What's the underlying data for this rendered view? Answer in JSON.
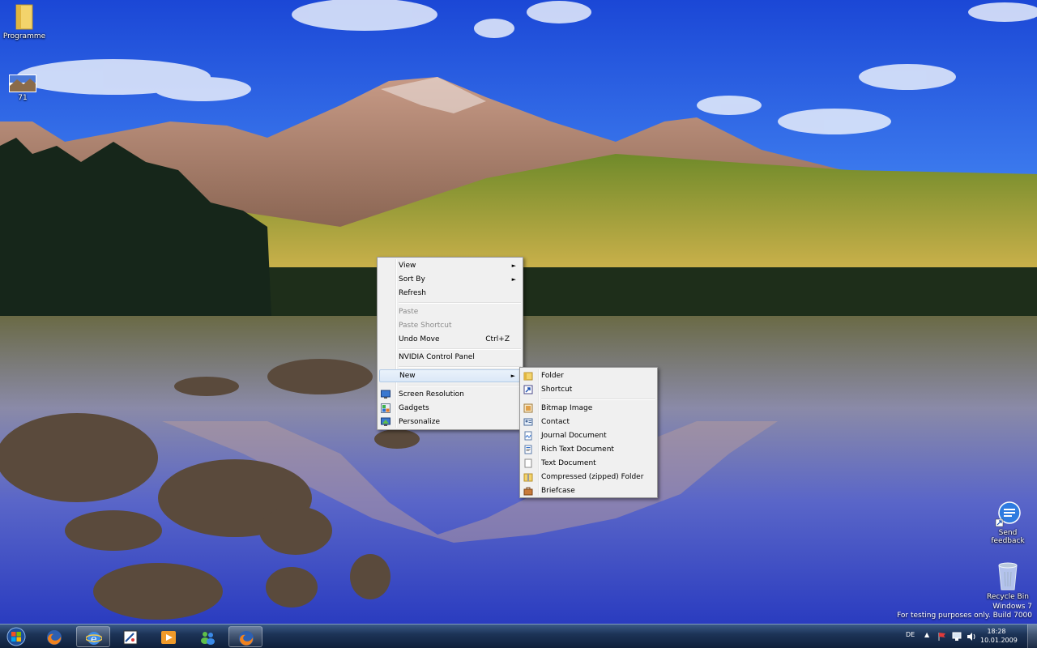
{
  "desktop": {
    "icons": [
      {
        "label": "Programme",
        "icon": "folder-icon"
      },
      {
        "label": "71",
        "icon": "image-file-icon"
      },
      {
        "label_line1": "Send",
        "label_line2": "feedback",
        "icon": "send-feedback-icon"
      },
      {
        "label": "Recycle Bin",
        "icon": "recycle-bin-icon"
      }
    ],
    "watermark": {
      "line1": "Windows 7",
      "line2": "For testing purposes only. Build 7000"
    }
  },
  "context_menu": {
    "items": [
      {
        "label": "View",
        "submenu": true
      },
      {
        "label": "Sort By",
        "submenu": true
      },
      {
        "label": "Refresh"
      },
      {
        "label": "Paste",
        "disabled": true
      },
      {
        "label": "Paste Shortcut",
        "disabled": true
      },
      {
        "label": "Undo Move",
        "accelerator": "Ctrl+Z"
      },
      {
        "label": "NVIDIA Control Panel"
      },
      {
        "label": "New",
        "submenu": true,
        "highlighted": true
      },
      {
        "label": "Screen Resolution",
        "icon": "display-icon"
      },
      {
        "label": "Gadgets",
        "icon": "gadgets-icon"
      },
      {
        "label": "Personalize",
        "icon": "personalize-icon"
      }
    ],
    "arrow_glyph": "►"
  },
  "new_submenu": {
    "items": [
      {
        "label": "Folder",
        "icon": "folder-icon"
      },
      {
        "label": "Shortcut",
        "icon": "shortcut-icon"
      },
      {
        "label": "Bitmap Image",
        "icon": "bitmap-icon"
      },
      {
        "label": "Contact",
        "icon": "contact-icon"
      },
      {
        "label": "Journal Document",
        "icon": "journal-icon"
      },
      {
        "label": "Rich Text Document",
        "icon": "rich-text-icon"
      },
      {
        "label": "Text Document",
        "icon": "text-document-icon"
      },
      {
        "label": "Compressed (zipped) Folder",
        "icon": "zip-folder-icon"
      },
      {
        "label": "Briefcase",
        "icon": "briefcase-icon"
      }
    ]
  },
  "taskbar": {
    "buttons": [
      {
        "name": "start-button",
        "icon": "windows-orb-icon"
      },
      {
        "name": "firefox",
        "icon": "firefox-icon"
      },
      {
        "name": "internet-explorer",
        "icon": "ie-icon",
        "active": true
      },
      {
        "name": "paint",
        "icon": "paint-icon"
      },
      {
        "name": "media-player",
        "icon": "media-player-icon"
      },
      {
        "name": "messenger",
        "icon": "messenger-icon"
      },
      {
        "name": "firefox-running",
        "icon": "firefox-icon",
        "active": true
      }
    ],
    "tray": {
      "language": "DE",
      "time": "18:28",
      "date": "10.01.2009"
    }
  },
  "colors": {
    "menu_bg": "#f0f0f0",
    "menu_border": "#979797",
    "taskbar": "#1d3458",
    "sky_top": "#1f4fd8",
    "disabled_text": "#8a8a8a"
  }
}
